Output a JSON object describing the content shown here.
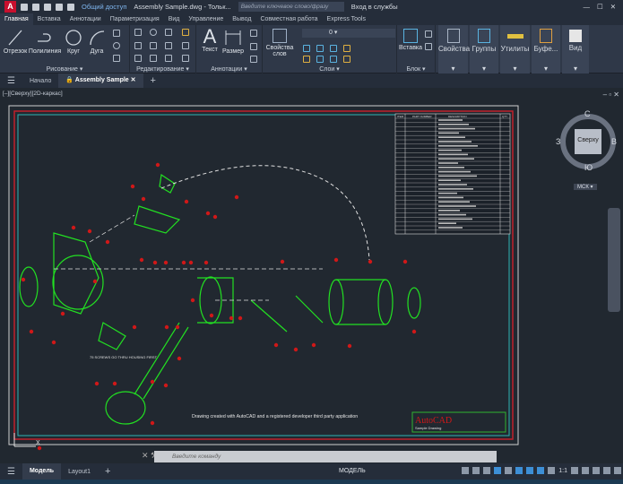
{
  "titlebar": {
    "logo": "A",
    "share": "Общий доступ",
    "title": "Assembly Sample.dwg - Тольк...",
    "search_placeholder": "Введите ключевое слово/фразу",
    "signin": "Вход в службы"
  },
  "ribbon_tabs": [
    "Главная",
    "Вставка",
    "Аннотации",
    "Параметризация",
    "Вид",
    "Управление",
    "Вывод",
    "Совместная работа",
    "Express Tools"
  ],
  "ribbon": {
    "draw": {
      "title": "Рисование ▾",
      "tools": [
        "Отрезок",
        "Полилиния",
        "Круг",
        "Дуга"
      ]
    },
    "modify": {
      "title": "Редактирование ▾"
    },
    "annot": {
      "title": "Аннотации ▾",
      "tools": [
        "Текст",
        "Размер"
      ]
    },
    "layers": {
      "title": "Слои ▾",
      "props": "Свойства слов",
      "layer_value": "0"
    },
    "block": {
      "title": "Блок ▾",
      "insert": "Вставка"
    },
    "right": [
      "Свойства",
      "Группы",
      "Утилиты",
      "Буфе...",
      "Вид"
    ]
  },
  "file_tabs": {
    "start": "Начало",
    "active": "Assembly Sample"
  },
  "viewport": {
    "label": "[–][Сверху][2D-каркас]"
  },
  "viewcube": {
    "top": "Сверху",
    "n": "С",
    "s": "Ю",
    "w": "З",
    "e": "В",
    "ucs": "МСК ▾"
  },
  "drawing": {
    "note": "Drawing created with AutoCAD and a registered developer third party application",
    "logo": "AutoCAD",
    "logo_sub": "Sample Drawing",
    "callout": "75 SCREWS GO THRU HOUSING FIRST",
    "bom_headers": [
      "ITEM",
      "PART NUMBER",
      "DESCRIPTION",
      "QTY"
    ]
  },
  "command": {
    "placeholder": "Введите команду"
  },
  "status": {
    "model_tab": "Модель",
    "layout_tab": "Layout1",
    "mode": "МОДЕЛЬ",
    "scale": "1:1"
  },
  "colors": {
    "accent": "#c8102e",
    "geometry": "#22e022",
    "sheet_border": "#c0202a",
    "inner_border": "#2fb4b4"
  }
}
